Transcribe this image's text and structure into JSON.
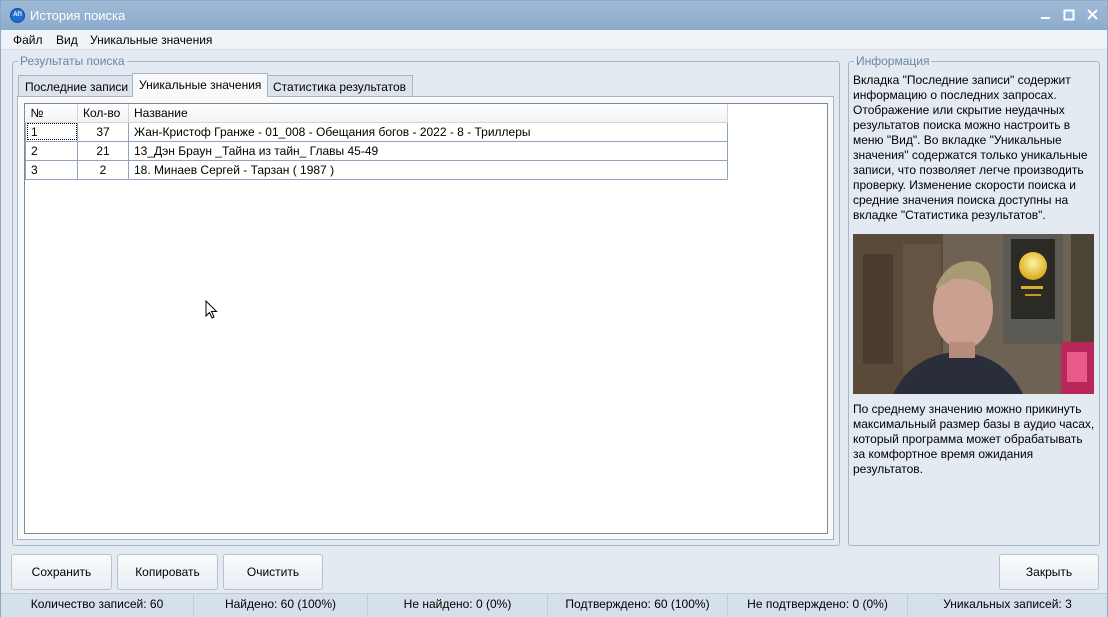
{
  "window": {
    "title": "История поиска",
    "app_icon_text": "АП",
    "icons": {
      "minimize": "minimize-icon",
      "maximize": "maximize-icon",
      "close": "close-icon"
    }
  },
  "menu": {
    "file": "Файл",
    "view": "Вид",
    "unique": "Уникальные значения"
  },
  "results_group": {
    "title": "Результаты поиска",
    "tabs": [
      "Последние записи",
      "Уникальные значения",
      "Статистика результатов"
    ],
    "active_tab": "Уникальные значения",
    "table": {
      "headers": [
        "№",
        "Кол-во",
        "Название"
      ],
      "rows": [
        {
          "no": "1",
          "count": "37",
          "name": "Жан-Кристоф Гранже - 01_008 - Обещания богов - 2022 - 8 - Триллеры"
        },
        {
          "no": "2",
          "count": "21",
          "name": "13_Дэн Браун _Тайна из тайн_ Главы 45-49"
        },
        {
          "no": "3",
          "count": "2",
          "name": "18. Минаев Сергей - Тарзан ( 1987 )"
        }
      ]
    }
  },
  "info_group": {
    "title": "Информация",
    "text_top": "Вкладка \"Последние записи\" содержит информацию о последних запросах. Отображение или скрытие неудачных результатов поиска можно настроить в меню \"Вид\". Во вкладке \"Уникальные значения\" содержатся только уникальные записи, что позволяет легче производить проверку. Изменение скорости поиска и средние значения поиска доступны на вкладке \"Статистика результатов\".",
    "text_bottom": "По среднему значению можно прикинуть максимальный размер базы в аудио часах, который программа может обрабатывать за комфортное время ожидания результатов."
  },
  "buttons": {
    "save": "Сохранить",
    "copy": "Копировать",
    "clear": "Очистить",
    "close": "Закрыть"
  },
  "status": {
    "records": "Количество записей: 60",
    "found": "Найдено: 60 (100%)",
    "not_found": "Не найдено: 0 (0%)",
    "confirmed": "Подтверждено: 60 (100%)",
    "not_confirmed": "Не подтверждено: 0 (0%)",
    "unique": "Уникальных записей: 3"
  }
}
